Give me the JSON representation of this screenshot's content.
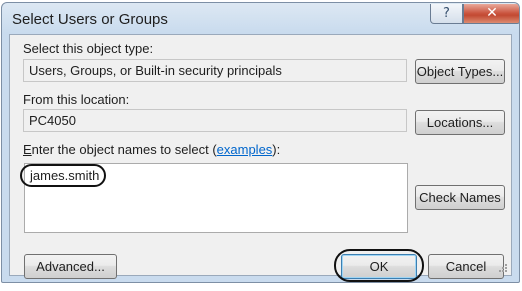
{
  "window": {
    "title": "Select Users or Groups",
    "help_glyph": "?",
    "close_glyph": "✕"
  },
  "object_type": {
    "label": "Select this object type:",
    "value": "Users, Groups, or Built-in security principals",
    "button": "Object Types..."
  },
  "location": {
    "label": "From this location:",
    "value": "PC4050",
    "button": "Locations..."
  },
  "names": {
    "label_first": "E",
    "label_rest": "nter the object names to select (",
    "link": "examples",
    "label_end": "):",
    "value": "james.smith",
    "check_button": "Check Names"
  },
  "footer": {
    "advanced_button": "Advanced...",
    "ok_button": "OK",
    "cancel_button": "Cancel"
  },
  "colors": {
    "title_gradient_top": "#dde8f3",
    "title_gradient_bottom": "#c9dbee",
    "close_button": "#c24a33",
    "link": "#0066cc",
    "annotation_ring": "#111111"
  },
  "icons": [
    "help-icon",
    "close-icon",
    "resize-grip-icon"
  ]
}
